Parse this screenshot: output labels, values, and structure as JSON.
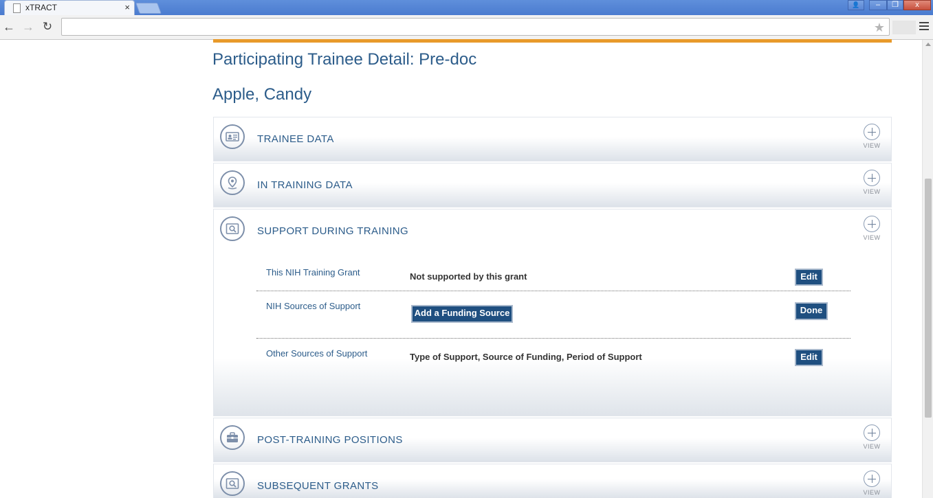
{
  "browser": {
    "tab_title": "xTRACT",
    "tab_close": "×",
    "address": "",
    "window_controls": {
      "user": "👤",
      "minimize": "–",
      "restore": "❐",
      "close": "x"
    }
  },
  "page": {
    "title": "Participating Trainee Detail: Pre-doc",
    "trainee_name": "Apple, Candy",
    "accent_color": "#e89a2b",
    "heading_color": "#2c5c8a"
  },
  "sections": [
    {
      "id": "trainee-data",
      "title": "TRAINEE DATA",
      "icon": "id-card-icon",
      "toggle_label": "VIEW"
    },
    {
      "id": "in-training-data",
      "title": "IN TRAINING DATA",
      "icon": "location-pin-icon",
      "toggle_label": "VIEW"
    },
    {
      "id": "support-during-training",
      "title": "SUPPORT DURING TRAINING",
      "icon": "magnifier-icon",
      "toggle_label": "VIEW"
    },
    {
      "id": "post-training-positions",
      "title": "POST-TRAINING POSITIONS",
      "icon": "briefcase-icon",
      "toggle_label": "VIEW"
    },
    {
      "id": "subsequent-grants",
      "title": "SUBSEQUENT GRANTS",
      "icon": "magnifier-icon",
      "toggle_label": "VIEW"
    }
  ],
  "support": {
    "rows": [
      {
        "label": "This NIH Training Grant",
        "value": "Not supported by this grant",
        "button": "Edit"
      },
      {
        "label": "NIH Sources of Support",
        "action_button": "Add a Funding Source",
        "button": "Done"
      },
      {
        "label": "Other Sources of Support",
        "value": "Type of Support, Source of Funding, Period of Support",
        "button": "Edit"
      }
    ],
    "button_color": "#1f4f80"
  }
}
